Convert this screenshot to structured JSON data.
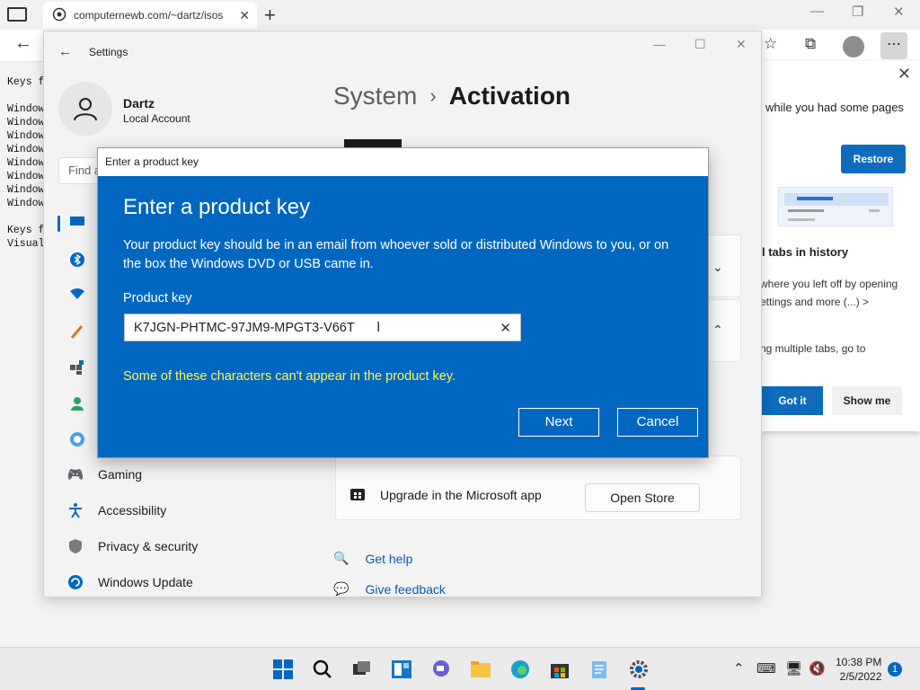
{
  "browser": {
    "tab_url": "computernewb.com/~dartz/isos",
    "tab_close": "✕",
    "new_tab": "+",
    "win_min": "—",
    "win_max": "❐",
    "win_close": "✕"
  },
  "page_text": "Keys f\n\nWindow\nWindow\nWindow\nWindow\nWindow\nWindow\nWindow\nWindow\n\nKeys f\nVisual",
  "edge_panel": {
    "restore_text": "while you had some pages",
    "restore_label": "Restore",
    "tip_title": "l tabs in history",
    "tip_desc": "where you left off by opening\nettings and more (...) >",
    "tip_desc2": "ng multiple tabs, go to",
    "got_it": "Got it",
    "show_me": "Show me"
  },
  "settings": {
    "title": "Settings",
    "user_name": "Dartz",
    "user_type": "Local Account",
    "find_placeholder": "Find a",
    "crumb_parent": "System",
    "crumb_sep": "›",
    "crumb_current": "Activation",
    "nav": [
      {
        "label": "Gaming"
      },
      {
        "label": "Accessibility"
      },
      {
        "label": "Privacy & security"
      },
      {
        "label": "Windows Update"
      }
    ],
    "upgrade_label": "Upgrade in the Microsoft app",
    "open_store": "Open Store",
    "get_help": "Get help",
    "give_feedback": "Give feedback"
  },
  "dialog": {
    "titlebar": "Enter a product key",
    "heading": "Enter a product key",
    "description": "Your product key should be in an email from whoever sold or distributed Windows to you, or on the box the Windows DVD or USB came in.",
    "label": "Product key",
    "input_value": "K7JGN-PHTMC-97JM9-MPGT3-V66T",
    "error": "Some of these characters can't appear in the product key.",
    "next": "Next",
    "cancel": "Cancel"
  },
  "taskbar": {
    "time": "10:38 PM",
    "date": "2/5/2022",
    "notification_count": "1"
  }
}
